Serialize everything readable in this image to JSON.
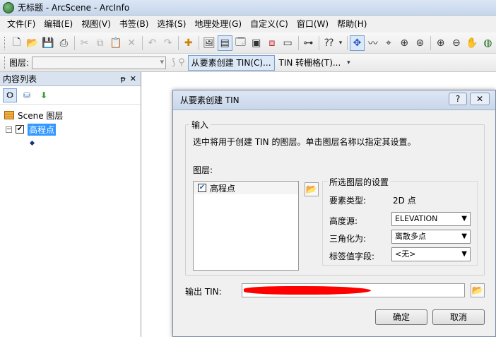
{
  "window": {
    "title": "无标题 - ArcScene - ArcInfo"
  },
  "menu": [
    "文件(F)",
    "编辑(E)",
    "视图(V)",
    "书签(B)",
    "选择(S)",
    "地理处理(G)",
    "自定义(C)",
    "窗口(W)",
    "帮助(H)"
  ],
  "layerbar": {
    "label": "图层:",
    "buttons": [
      "从要素创建 TIN(C)...",
      "TIN 转栅格(T)..."
    ]
  },
  "toc": {
    "title": "内容列表",
    "pin": "ᵽ",
    "close": "✕",
    "scene_layers": "Scene 图层",
    "layer_name": "高程点"
  },
  "dialog": {
    "title": "从要素创建 TIN",
    "help": "?",
    "close": "✕",
    "group_title": "输入",
    "instruction": "选中将用于创建 TIN 的图层。单击图层名称以指定其设置。",
    "layers_label": "图层:",
    "list_items": [
      "高程点"
    ],
    "settings_title": "所选图层的设置",
    "feature_type_label": "要素类型:",
    "feature_type_value": "2D 点",
    "height_source_label": "高度源:",
    "height_source_value": "ELEVATION",
    "triangulate_label": "三角化为:",
    "triangulate_value": "离散多点",
    "tag_field_label": "标签值字段:",
    "tag_field_value": "<无>",
    "output_label": "输出 TIN:",
    "ok": "确定",
    "cancel": "取消"
  }
}
